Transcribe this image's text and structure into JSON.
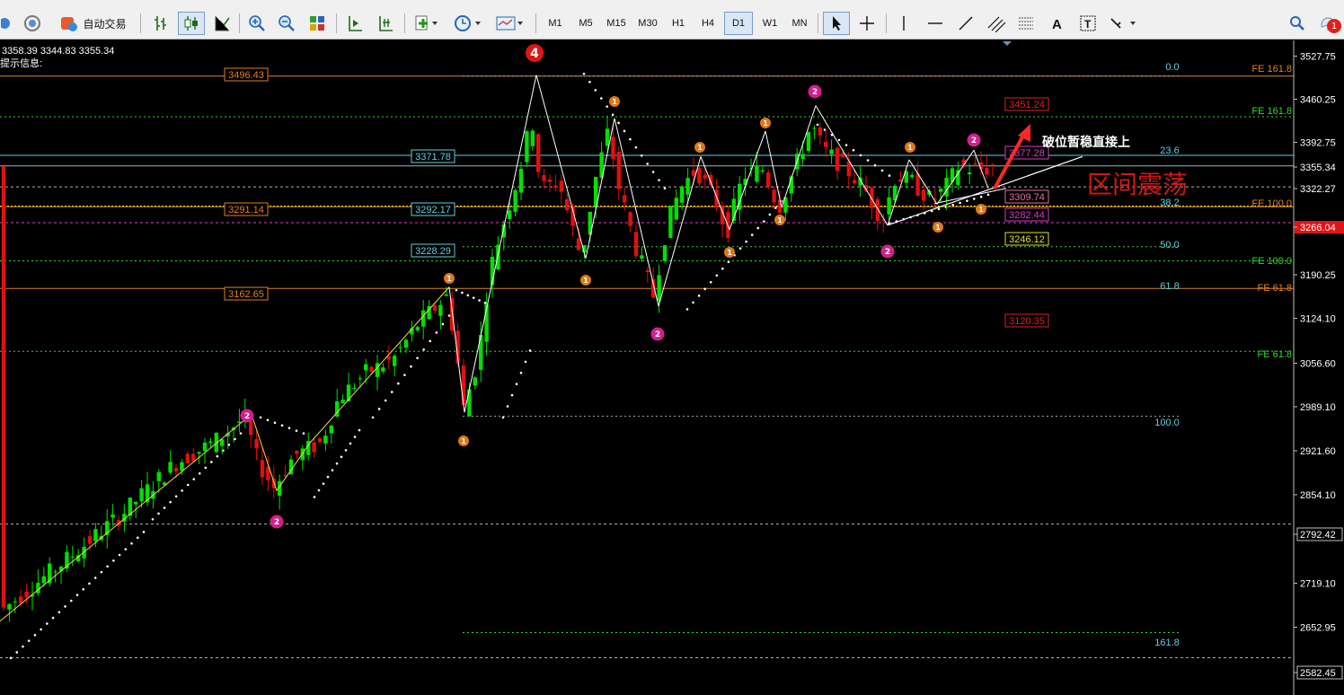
{
  "toolbar": {
    "auto_trading_label": "自动交易",
    "timeframes": [
      "M1",
      "M5",
      "M15",
      "M30",
      "H1",
      "H4",
      "D1",
      "W1",
      "MN"
    ],
    "active_timeframe": "D1",
    "notification_count": "1"
  },
  "chart": {
    "ohlc_readout": "3358.39 3344.83 3355.34",
    "info_label": "提示信息:",
    "price_axis": [
      "3527.75",
      "3460.25",
      "3392.75",
      "3355.34",
      "3322.27",
      "3266.04",
      "3190.25",
      "3124.10",
      "3056.60",
      "2989.10",
      "2921.60",
      "2854.10",
      "2792.42",
      "2719.10",
      "2652.95",
      "2582.45"
    ],
    "current_price": "3355.34",
    "red_marker_price": "3266.04",
    "level_labels": [
      {
        "text": "3496.43",
        "type": "orange"
      },
      {
        "text": "3371.78",
        "type": "cyan"
      },
      {
        "text": "3291.14",
        "type": "orange"
      },
      {
        "text": "3292.17",
        "type": "cyan"
      },
      {
        "text": "3228.29",
        "type": "cyan"
      },
      {
        "text": "3162.65",
        "type": "orange"
      },
      {
        "text": "3451.24",
        "type": "red"
      },
      {
        "text": "3377.28",
        "type": "magenta"
      },
      {
        "text": "3309.74",
        "type": "pink"
      },
      {
        "text": "3282.44",
        "type": "magenta"
      },
      {
        "text": "3246.12",
        "type": "yellow"
      },
      {
        "text": "3120.35",
        "type": "red"
      }
    ],
    "fib_levels": [
      "0.0",
      "23.6",
      "38.2",
      "50.0",
      "61.8",
      "100.0",
      "161.8"
    ],
    "fe_levels": [
      "FE 161.8",
      "FE 161.8",
      "FE 100.0",
      "FE 100.0",
      "FE 61.8",
      "FE 61.8"
    ],
    "wave_marker_4": "4",
    "wave_labels": [
      "1",
      "2"
    ],
    "annotation_breakout": "破位暂稳直接上",
    "annotation_range": "区间震荡",
    "colors": {
      "bull": "#00e000",
      "bear": "#e01010",
      "fib": "#e08020",
      "accent": "#e02020",
      "fe": "#2fd82f"
    }
  }
}
